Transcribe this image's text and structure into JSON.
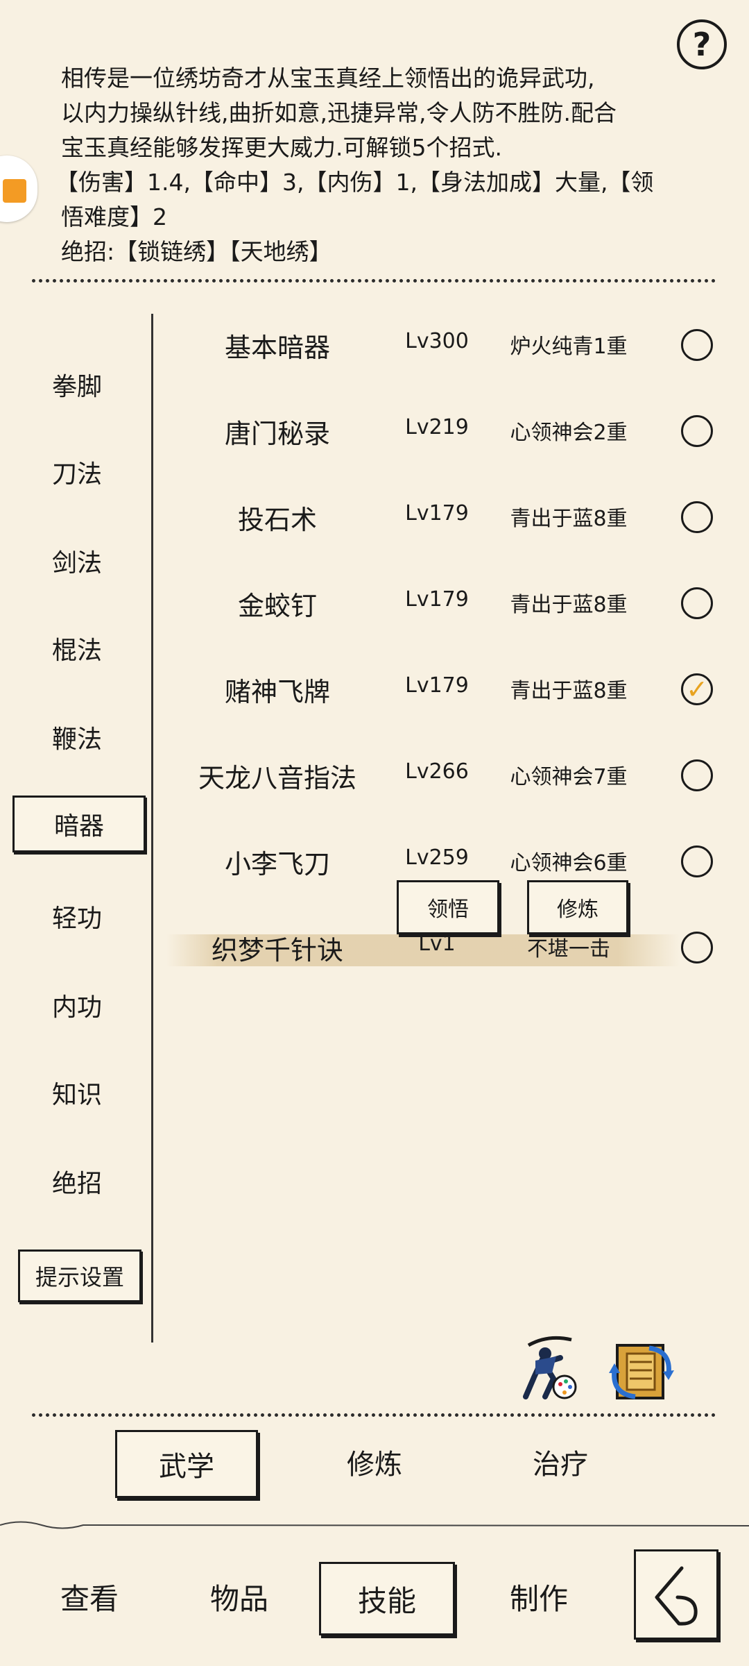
{
  "description": {
    "line1": "相传是一位绣坊奇才从宝玉真经上领悟出的诡异武功,",
    "line2": "以内力操纵针线,曲折如意,迅捷异常,令人防不胜防.配合",
    "line3": "宝玉真经能够发挥更大威力.可解锁5个招式.",
    "line4": "【伤害】1.4,【命中】3,【内伤】1,【身法加成】大量,【领",
    "line5": "悟难度】2",
    "line6": "绝招:【锁链绣】【天地绣】"
  },
  "help_icon": "question-mark-icon",
  "categories": [
    "拳脚",
    "刀法",
    "剑法",
    "棍法",
    "鞭法",
    "暗器",
    "轻功",
    "内功",
    "知识",
    "绝招"
  ],
  "active_category": "暗器",
  "tip_settings_label": "提示设置",
  "skills": [
    {
      "name": "基本暗器",
      "level": "Lv300",
      "tier": "炉火纯青1重",
      "checked": false
    },
    {
      "name": "唐门秘录",
      "level": "Lv219",
      "tier": "心领神会2重",
      "checked": false
    },
    {
      "name": "投石术",
      "level": "Lv179",
      "tier": "青出于蓝8重",
      "checked": false
    },
    {
      "name": "金蛟钉",
      "level": "Lv179",
      "tier": "青出于蓝8重",
      "checked": false
    },
    {
      "name": "赌神飞牌",
      "level": "Lv179",
      "tier": "青出于蓝8重",
      "checked": true
    },
    {
      "name": "天龙八音指法",
      "level": "Lv266",
      "tier": "心领神会7重",
      "checked": false
    },
    {
      "name": "小李飞刀",
      "level": "Lv259",
      "tier": "心领神会6重",
      "checked": false
    },
    {
      "name": "织梦千针诀",
      "level": "Lv1",
      "tier": "不堪一击",
      "checked": false
    }
  ],
  "popup": {
    "comprehend_label": "领悟",
    "train_label": "修炼"
  },
  "action_icons": [
    "ninja-skill-icon",
    "scroll-swap-icon"
  ],
  "subtabs": [
    "武学",
    "修炼",
    "治疗"
  ],
  "active_subtab": "武学",
  "nav": [
    "查看",
    "物品",
    "技能",
    "制作"
  ],
  "active_nav": "技能",
  "back_icon": "back-arrow-icon"
}
